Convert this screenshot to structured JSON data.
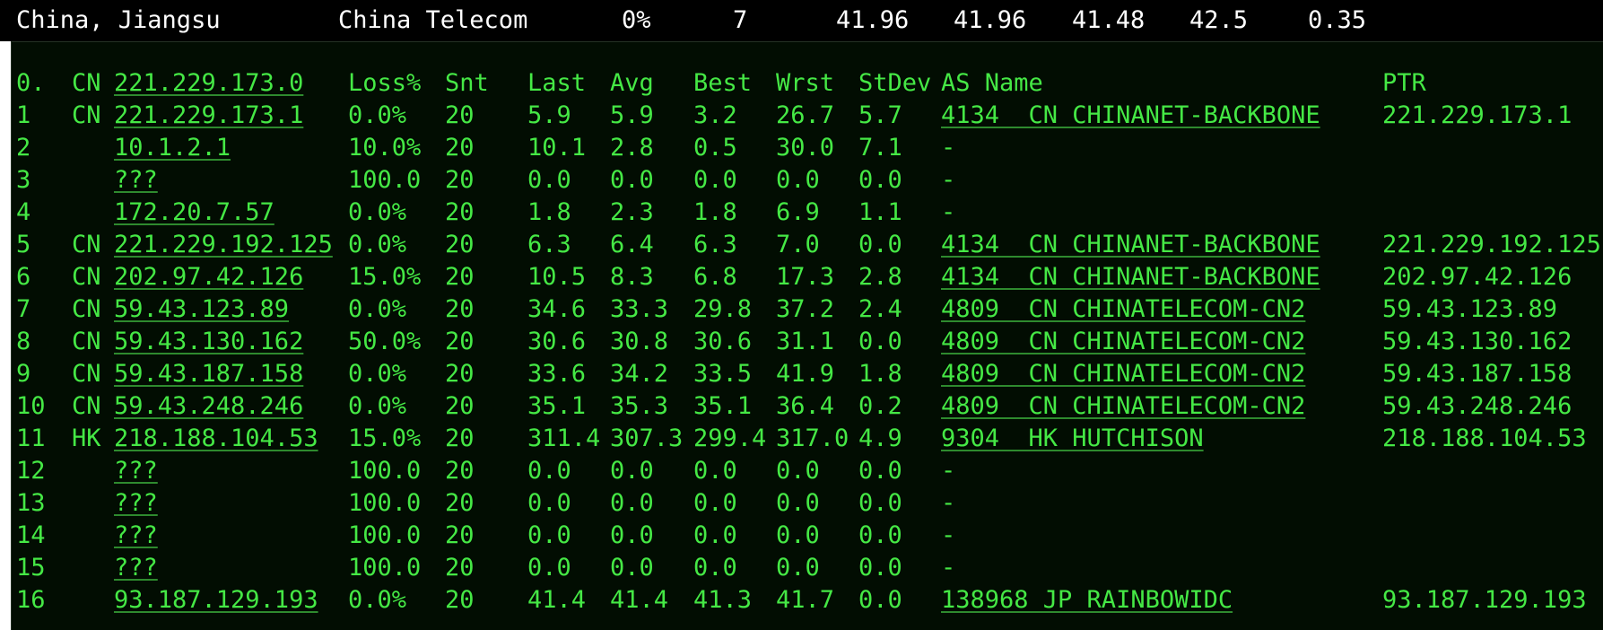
{
  "summary": {
    "location": "China, Jiangsu",
    "isp": "China Telecom",
    "loss": "0%",
    "sent": "7",
    "last": "41.96",
    "avg": "41.96",
    "best": "41.48",
    "worst": "42.5",
    "stdev": "0.35"
  },
  "colors": {
    "text": "#45e845",
    "header_text": "#ffffff",
    "background": "#020d02"
  },
  "table": {
    "header": {
      "hop": "0.",
      "cc": "CN",
      "host": "221.229.173.0",
      "loss": "Loss%",
      "snt": "Snt",
      "last": "Last",
      "avg": "Avg",
      "best": "Best",
      "wrst": "Wrst",
      "stdev": "StDev",
      "as_name": "AS Name",
      "ptr": "PTR"
    },
    "rows": [
      {
        "hop": "1",
        "cc": "CN",
        "host": "221.229.173.1",
        "loss": "0.0%",
        "snt": "20",
        "last": "5.9",
        "avg": "5.9",
        "best": "3.2",
        "wrst": "26.7",
        "stdev": "5.7",
        "as_name": "4134  CN CHINANET-BACKBONE",
        "ptr": "221.229.173.1"
      },
      {
        "hop": "2",
        "cc": "",
        "host": "10.1.2.1",
        "loss": "10.0%",
        "snt": "20",
        "last": "10.1",
        "avg": "2.8",
        "best": "0.5",
        "wrst": "30.0",
        "stdev": "7.1",
        "as_name": "-",
        "ptr": ""
      },
      {
        "hop": "3",
        "cc": "",
        "host": "???",
        "loss": "100.0",
        "snt": "20",
        "last": "0.0",
        "avg": "0.0",
        "best": "0.0",
        "wrst": "0.0",
        "stdev": "0.0",
        "as_name": "-",
        "ptr": ""
      },
      {
        "hop": "4",
        "cc": "",
        "host": "172.20.7.57",
        "loss": "0.0%",
        "snt": "20",
        "last": "1.8",
        "avg": "2.3",
        "best": "1.8",
        "wrst": "6.9",
        "stdev": "1.1",
        "as_name": "-",
        "ptr": ""
      },
      {
        "hop": "5",
        "cc": "CN",
        "host": "221.229.192.125",
        "loss": "0.0%",
        "snt": "20",
        "last": "6.3",
        "avg": "6.4",
        "best": "6.3",
        "wrst": "7.0",
        "stdev": "0.0",
        "as_name": "4134  CN CHINANET-BACKBONE",
        "ptr": "221.229.192.125"
      },
      {
        "hop": "6",
        "cc": "CN",
        "host": "202.97.42.126",
        "loss": "15.0%",
        "snt": "20",
        "last": "10.5",
        "avg": "8.3",
        "best": "6.8",
        "wrst": "17.3",
        "stdev": "2.8",
        "as_name": "4134  CN CHINANET-BACKBONE",
        "ptr": "202.97.42.126"
      },
      {
        "hop": "7",
        "cc": "CN",
        "host": "59.43.123.89",
        "loss": "0.0%",
        "snt": "20",
        "last": "34.6",
        "avg": "33.3",
        "best": "29.8",
        "wrst": "37.2",
        "stdev": "2.4",
        "as_name": "4809  CN CHINATELECOM-CN2",
        "ptr": "59.43.123.89"
      },
      {
        "hop": "8",
        "cc": "CN",
        "host": "59.43.130.162",
        "loss": "50.0%",
        "snt": "20",
        "last": "30.6",
        "avg": "30.8",
        "best": "30.6",
        "wrst": "31.1",
        "stdev": "0.0",
        "as_name": "4809  CN CHINATELECOM-CN2",
        "ptr": "59.43.130.162"
      },
      {
        "hop": "9",
        "cc": "CN",
        "host": "59.43.187.158",
        "loss": "0.0%",
        "snt": "20",
        "last": "33.6",
        "avg": "34.2",
        "best": "33.5",
        "wrst": "41.9",
        "stdev": "1.8",
        "as_name": "4809  CN CHINATELECOM-CN2",
        "ptr": "59.43.187.158"
      },
      {
        "hop": "10",
        "cc": "CN",
        "host": "59.43.248.246",
        "loss": "0.0%",
        "snt": "20",
        "last": "35.1",
        "avg": "35.3",
        "best": "35.1",
        "wrst": "36.4",
        "stdev": "0.2",
        "as_name": "4809  CN CHINATELECOM-CN2",
        "ptr": "59.43.248.246"
      },
      {
        "hop": "11",
        "cc": "HK",
        "host": "218.188.104.53",
        "loss": "15.0%",
        "snt": "20",
        "last": "311.4",
        "avg": "307.3",
        "best": "299.4",
        "wrst": "317.0",
        "stdev": "4.9",
        "as_name": "9304  HK HUTCHISON",
        "ptr": "218.188.104.53"
      },
      {
        "hop": "12",
        "cc": "",
        "host": "???",
        "loss": "100.0",
        "snt": "20",
        "last": "0.0",
        "avg": "0.0",
        "best": "0.0",
        "wrst": "0.0",
        "stdev": "0.0",
        "as_name": "-",
        "ptr": ""
      },
      {
        "hop": "13",
        "cc": "",
        "host": "???",
        "loss": "100.0",
        "snt": "20",
        "last": "0.0",
        "avg": "0.0",
        "best": "0.0",
        "wrst": "0.0",
        "stdev": "0.0",
        "as_name": "-",
        "ptr": ""
      },
      {
        "hop": "14",
        "cc": "",
        "host": "???",
        "loss": "100.0",
        "snt": "20",
        "last": "0.0",
        "avg": "0.0",
        "best": "0.0",
        "wrst": "0.0",
        "stdev": "0.0",
        "as_name": "-",
        "ptr": ""
      },
      {
        "hop": "15",
        "cc": "",
        "host": "???",
        "loss": "100.0",
        "snt": "20",
        "last": "0.0",
        "avg": "0.0",
        "best": "0.0",
        "wrst": "0.0",
        "stdev": "0.0",
        "as_name": "-",
        "ptr": ""
      },
      {
        "hop": "16",
        "cc": "",
        "host": "93.187.129.193",
        "loss": "0.0%",
        "snt": "20",
        "last": "41.4",
        "avg": "41.4",
        "best": "41.3",
        "wrst": "41.7",
        "stdev": "0.0",
        "as_name": "138968 JP RAINBOWIDC",
        "ptr": "93.187.129.193"
      }
    ]
  }
}
